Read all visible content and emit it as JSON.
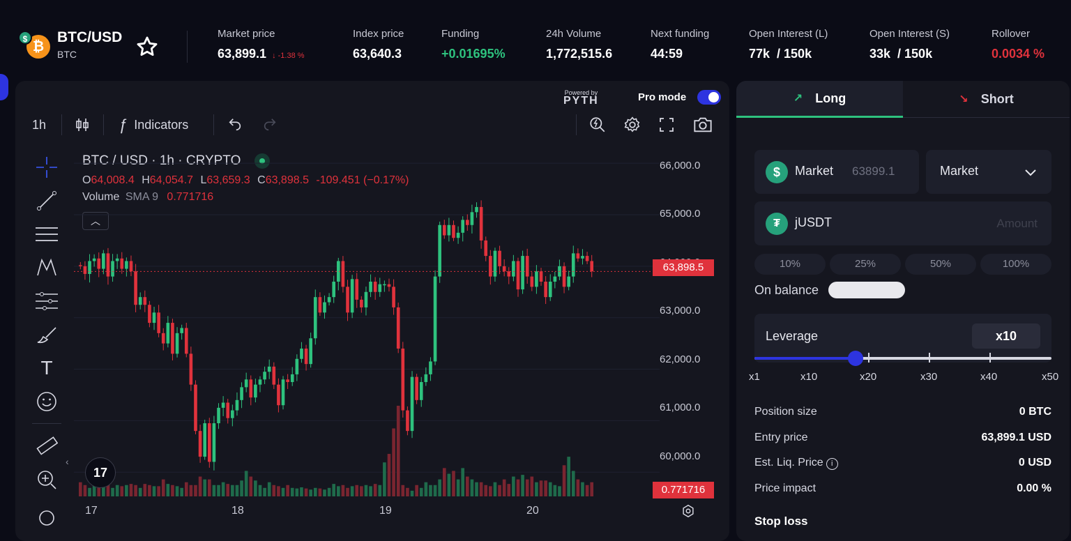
{
  "pair": {
    "name": "BTC/USD",
    "sub": "BTC",
    "logo_icon": "btc-icon",
    "quote_icon": "usd-icon"
  },
  "stats": [
    {
      "label": "Market price",
      "value": "63,899.1",
      "change": "↓ -1.38 %"
    },
    {
      "label": "Index price",
      "value": "63,640.3"
    },
    {
      "label": "Funding",
      "value": "+0.01695%"
    },
    {
      "label": "24h Volume",
      "value": "1,772,515.6"
    },
    {
      "label": "Next funding",
      "value": "44:59"
    },
    {
      "label": "Open Interest (L)",
      "value": "77k  / 150k"
    },
    {
      "label": "Open Interest (S)",
      "value": "33k  / 150k"
    },
    {
      "label": "Rollover",
      "value": "0.0034 %"
    }
  ],
  "chart_header": {
    "powered_by": "Powered by",
    "powered_name": "PYTH",
    "pro_mode": "Pro mode",
    "pro_mode_on": true
  },
  "toolbar": {
    "interval": "1h",
    "indicators": "Indicators"
  },
  "legend": {
    "title": "BTC / USD · 1h · CRYPTO",
    "o_label": "O",
    "o": "64,008.4",
    "h_label": "H",
    "h": "64,054.7",
    "l_label": "L",
    "l": "63,659.3",
    "c_label": "C",
    "c": "63,898.5",
    "change": "-109.451 (−0.17%)",
    "volume_label": "Volume",
    "sma_label": "SMA 9",
    "volume_value": "0.771716"
  },
  "price_axis": [
    "66,000.0",
    "65,000.0",
    "64,000.0",
    "63,000.0",
    "62,000.0",
    "61,000.0",
    "60,000.0"
  ],
  "time_axis": [
    "17",
    "18",
    "19",
    "20"
  ],
  "last_price_tag": "63,898.5",
  "volume_tag": "0.771716",
  "colors": {
    "up": "#2ec27e",
    "down": "#e0323c",
    "accent": "#2d34e0",
    "bg": "#0b0c16",
    "panel": "#15161f"
  },
  "chart_data": {
    "type": "candlestick",
    "interval": "1h",
    "xlabels": [
      "17",
      "18",
      "19",
      "20"
    ],
    "ylim": [
      59800,
      66300
    ],
    "yticks": [
      66000,
      65000,
      64000,
      63000,
      62000,
      61000,
      60000
    ],
    "last_price": 63898.5,
    "closes": [
      64000,
      63850,
      64100,
      64150,
      63950,
      64250,
      63800,
      64100,
      64150,
      63950,
      64100,
      63900,
      63250,
      63400,
      63250,
      62900,
      63100,
      62700,
      62500,
      62900,
      62300,
      62700,
      62800,
      62300,
      61700,
      60800,
      60300,
      60950,
      60200,
      60950,
      61250,
      61350,
      61050,
      61200,
      61400,
      61650,
      61800,
      61450,
      61700,
      61800,
      61950,
      62050,
      61700,
      61300,
      61800,
      61750,
      61900,
      62200,
      62400,
      62100,
      62600,
      63400,
      63100,
      63300,
      63400,
      63700,
      64100,
      63600,
      63100,
      63750,
      63350,
      63200,
      63500,
      63700,
      63500,
      63650,
      63650,
      63600,
      63200,
      62400,
      61200,
      60800,
      61850,
      61400,
      61750,
      61900,
      62150,
      63800,
      64800,
      64600,
      64800,
      64550,
      64650,
      64900,
      64800,
      65050,
      65150,
      64500,
      64200,
      63800,
      64300,
      64000,
      63900,
      63800,
      64100,
      63550,
      64200,
      63800,
      63600,
      63900,
      63700,
      63400,
      63700,
      63800,
      64000,
      63600,
      63800,
      64250,
      64150,
      64200,
      64100,
      63900
    ],
    "volumes": [
      0.25,
      0.2,
      0.15,
      0.22,
      0.18,
      0.2,
      0.25,
      0.15,
      0.2,
      0.18,
      0.2,
      0.22,
      0.2,
      0.15,
      0.22,
      0.2,
      0.18,
      0.18,
      0.3,
      0.22,
      0.2,
      0.18,
      0.15,
      0.25,
      0.2,
      0.2,
      0.35,
      0.3,
      0.3,
      0.2,
      0.2,
      0.25,
      0.22,
      0.2,
      0.2,
      0.28,
      0.45,
      0.35,
      0.28,
      0.2,
      0.15,
      0.25,
      0.2,
      0.18,
      0.15,
      0.2,
      0.15,
      0.14,
      0.16,
      0.14,
      0.12,
      0.15,
      0.14,
      0.12,
      0.15,
      0.22,
      0.18,
      0.2,
      0.15,
      0.18,
      0.2,
      0.18,
      0.2,
      0.18,
      0.22,
      0.2,
      0.6,
      0.75,
      1.2,
      1.6,
      0.2,
      0.15,
      0.1,
      0.2,
      0.15,
      0.25,
      0.2,
      0.2,
      0.3,
      0.5,
      0.4,
      0.45,
      0.3,
      0.5,
      0.35,
      0.3,
      0.25,
      0.25,
      0.2,
      0.18,
      0.25,
      0.2,
      0.3,
      0.22,
      0.35,
      0.3,
      0.38,
      0.3,
      0.35,
      0.25,
      0.28,
      0.28,
      0.25,
      0.2,
      0.18,
      0.55,
      0.7,
      0.45,
      0.3,
      0.25,
      0.2,
      0.25
    ]
  },
  "order": {
    "tab_long": "Long",
    "tab_short": "Short",
    "order_type": "Market",
    "price_placeholder": "63899.1",
    "order_type_select": "Market",
    "collateral": "jUSDT",
    "amount_placeholder": "Amount",
    "percents": [
      "10%",
      "25%",
      "50%",
      "100%"
    ],
    "on_balance": "On balance",
    "leverage_label": "Leverage",
    "leverage_value": "x10",
    "leverage_current": 10,
    "leverage_min": 1,
    "leverage_max": 50,
    "leverage_ticks": [
      "x1",
      "x10",
      "x20",
      "x30",
      "x40",
      "x50"
    ],
    "rows": [
      {
        "label": "Position size",
        "value": "0 BTC"
      },
      {
        "label": "Entry price",
        "value": "63,899.1 USD"
      },
      {
        "label": "Est. Liq. Price",
        "value": "0 USD",
        "info": true
      },
      {
        "label": "Price impact",
        "value": "0.00 %"
      }
    ],
    "stop_loss": "Stop loss"
  }
}
